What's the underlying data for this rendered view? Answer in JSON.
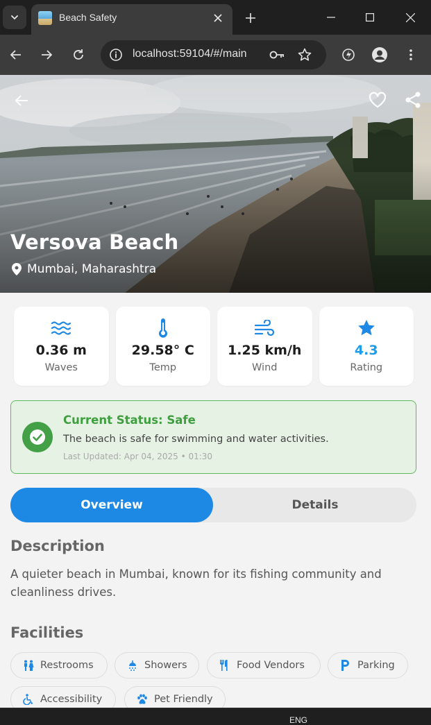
{
  "browser": {
    "tab_title": "Beach Safety",
    "url": "localhost:59104/#/main"
  },
  "hero": {
    "beach_name": "Versova Beach",
    "location": "Mumbai, Maharashtra"
  },
  "stats": [
    {
      "icon": "waves-icon",
      "value": "0.36 m",
      "label": "Waves"
    },
    {
      "icon": "thermometer-icon",
      "value": "29.58° C",
      "label": "Temp"
    },
    {
      "icon": "wind-icon",
      "value": "1.25 km/h",
      "label": "Wind"
    },
    {
      "icon": "star-icon",
      "value": "4.3",
      "label": "Rating"
    }
  ],
  "status": {
    "title": "Current Status: Safe",
    "description": "The beach is safe for swimming and water activities.",
    "updated": "Last Updated: Apr 04, 2025 • 01:30",
    "color": "#43a047"
  },
  "tabs": {
    "overview": "Overview",
    "details": "Details"
  },
  "description": {
    "title": "Description",
    "text": "A quieter beach in Mumbai, known for its fishing community and cleanliness drives."
  },
  "facilities": {
    "title": "Facilities",
    "items": [
      {
        "icon": "restroom-icon",
        "label": "Restrooms"
      },
      {
        "icon": "shower-icon",
        "label": "Showers"
      },
      {
        "icon": "food-icon",
        "label": "Food Vendors"
      },
      {
        "icon": "parking-icon",
        "label": "Parking"
      },
      {
        "icon": "accessibility-icon",
        "label": "Accessibility"
      },
      {
        "icon": "paw-icon",
        "label": "Pet Friendly"
      }
    ]
  },
  "taskbar": {
    "lang": "ENG"
  },
  "colors": {
    "accent": "#1e88e5",
    "icon_blue": "#1e88e5",
    "rating": "#1e9be9",
    "safe": "#43a047"
  }
}
